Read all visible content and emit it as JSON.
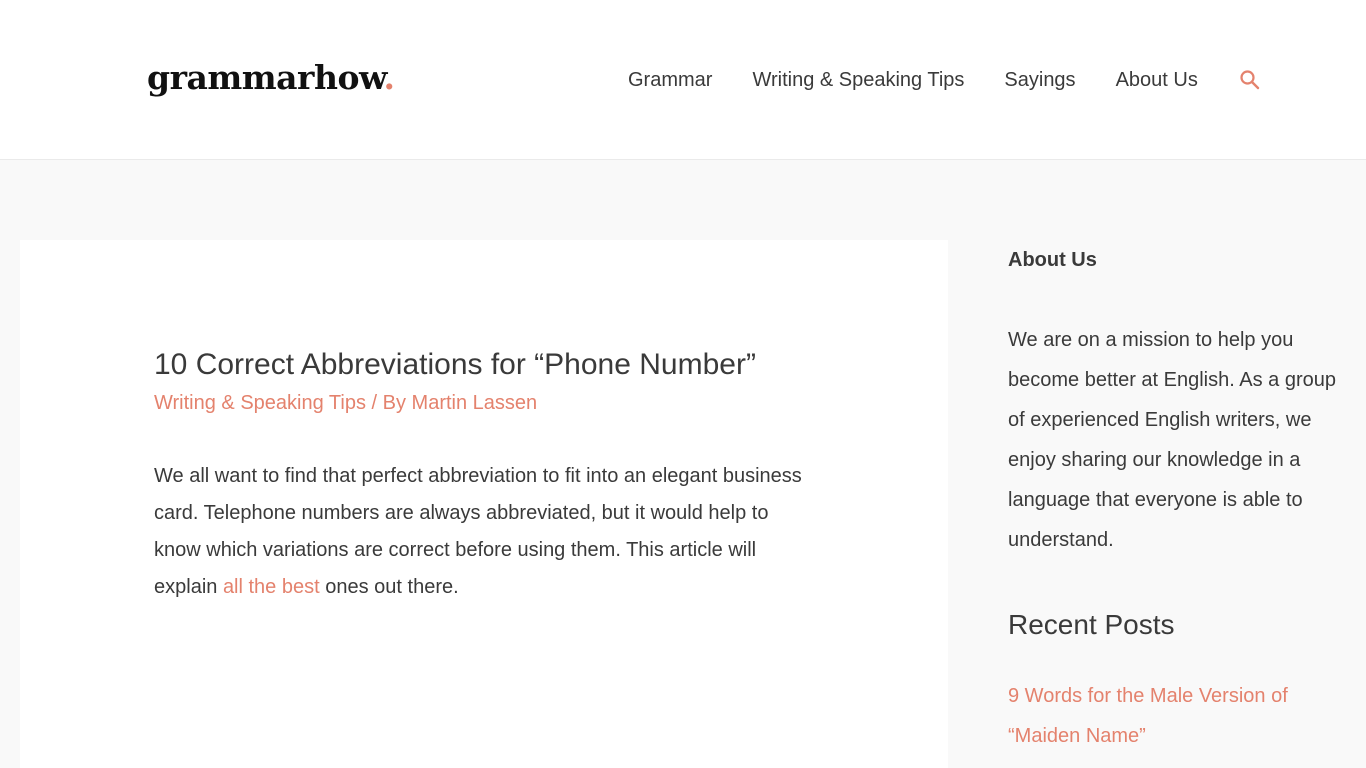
{
  "brand": {
    "logo_text": "grammarhow",
    "logo_dot": ".",
    "accent_color": "#e4826d"
  },
  "nav": {
    "items": [
      {
        "label": "Grammar"
      },
      {
        "label": "Writing & Speaking Tips"
      },
      {
        "label": "Sayings"
      },
      {
        "label": "About Us"
      }
    ],
    "search_icon": "search-icon"
  },
  "article": {
    "title": "10 Correct Abbreviations for “Phone Number”",
    "category": "Writing & Speaking Tips",
    "meta_separator": " / By ",
    "author": "Martin Lassen",
    "excerpt_before_link": "We all want to find that perfect abbreviation to fit into an elegant business card. Telephone numbers are always abbreviated, but it would help to know which variations are correct before using them. This article will explain ",
    "excerpt_link": "all the best",
    "excerpt_after_link": " ones out there."
  },
  "sidebar": {
    "about": {
      "title": "About Us",
      "text": "We are on a mission to help you become better at English. As a group of experienced English writers, we enjoy sharing our knowledge in a language that everyone is able to understand."
    },
    "recent_posts": {
      "title": "Recent Posts",
      "items": [
        {
          "label": "9 Words for the Male Version of “Maiden Name”"
        }
      ]
    }
  }
}
